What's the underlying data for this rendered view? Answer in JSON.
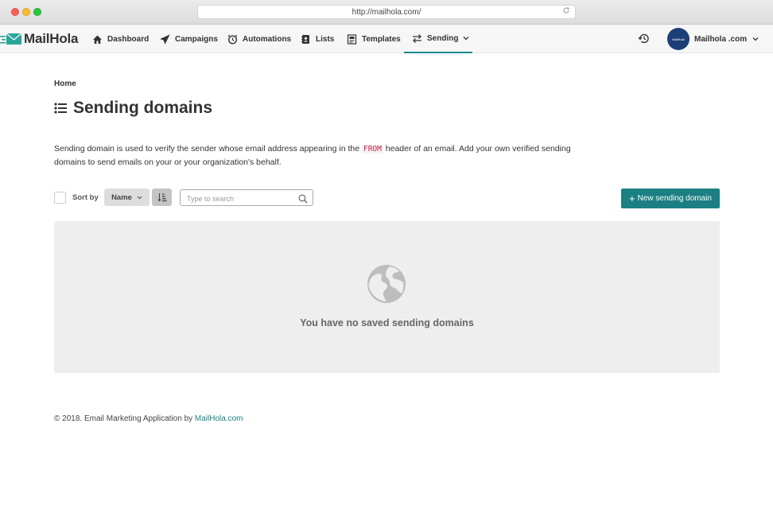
{
  "browser": {
    "url": "http://mailhola.com/",
    "icons": [
      "close-dot",
      "minimize-dot",
      "maximize-dot",
      "reload-icon"
    ]
  },
  "nav": {
    "brand": "MailHola",
    "items": [
      {
        "label": "Dashboard",
        "icon": "home-icon"
      },
      {
        "label": "Campaigns",
        "icon": "paper-plane-icon"
      },
      {
        "label": "Automations",
        "icon": "alarm-clock-icon"
      },
      {
        "label": "Lists",
        "icon": "address-book-icon"
      },
      {
        "label": "Templates",
        "icon": "template-icon"
      },
      {
        "label": "Sending",
        "icon": "exchange-icon",
        "active": true
      }
    ],
    "user": "Mailhola .com",
    "avatar_text": "MailHola"
  },
  "breadcrumb": "Home",
  "page": {
    "title": "Sending domains",
    "desc_before": "Sending domain is used to verify the sender whose email address appearing in the ",
    "desc_code": "FROM",
    "desc_after": " header of an email. Add your own verified sending domains to send emails on your or your organization's behalf."
  },
  "toolbar": {
    "sort_label": "Sort by",
    "sort_value": "Name",
    "search_placeholder": "Type to search",
    "new_button": "New sending domain"
  },
  "empty": {
    "message": "You have no saved sending domains"
  },
  "footer": {
    "text": "© 2018. Email Marketing Application by ",
    "link": "MailHola.com"
  },
  "colors": {
    "accent": "#1b7f83",
    "code": "#c7254e",
    "avatar": "#1d3f78"
  }
}
